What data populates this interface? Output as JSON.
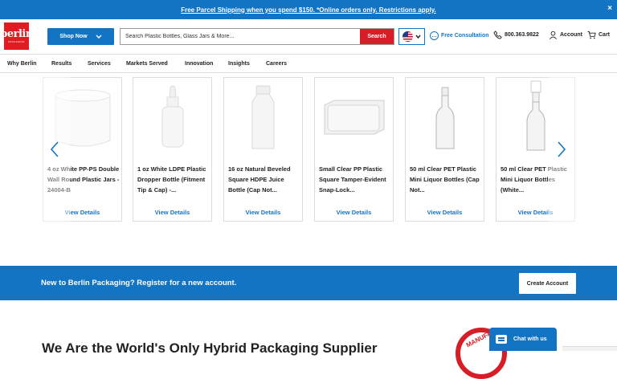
{
  "announcement": {
    "text": "Free Parcel Shipping when you spend $150. *Online orders only. Restrictions apply.",
    "close": "×"
  },
  "header": {
    "logo_text": "berlin",
    "logo_subtext": "PACKAGING",
    "shop_now_label": "Shop Now",
    "search_placeholder": "Search Plastic Bottles, Glass Jars & More...",
    "search_button": "Search",
    "free_consultation": "Free Consultation",
    "phone": "800.363.9822",
    "account": "Account",
    "cart": "Cart"
  },
  "nav": {
    "items": [
      "Why Berlin",
      "Results",
      "Services",
      "Markets Served",
      "Innovation",
      "Insights",
      "Careers"
    ]
  },
  "carousel": {
    "view_label": "View Details",
    "products": [
      {
        "title": "4 oz White PP-PS Double Wall Round Plastic Jars - 24004-B"
      },
      {
        "title": "1 oz White LDPE Plastic Dropper Bottle (Fitment Tip & Cap) -..."
      },
      {
        "title": "16 oz Natural Beveled Square HDPE Juice Bottle (Cap Not..."
      },
      {
        "title": "Small Clear PP Plastic Square Tamper-Evident Snap-Lock..."
      },
      {
        "title": "50 ml Clear PET Plastic Mini Liquor Bottles (Cap Not..."
      },
      {
        "title": "50 ml Clear PET Plastic Mini Liquor Bottles (White..."
      }
    ]
  },
  "register": {
    "text": "New to Berlin Packaging? Register for a new account.",
    "button": "Create Account"
  },
  "hybrid_heading": "We Are the World's Only Hybrid Packaging Supplier",
  "stamp_text": "MANUFA",
  "chat": {
    "label": "Chat with us"
  },
  "colors": {
    "brand_blue": "#1474c4",
    "brand_red": "#e11b22"
  }
}
